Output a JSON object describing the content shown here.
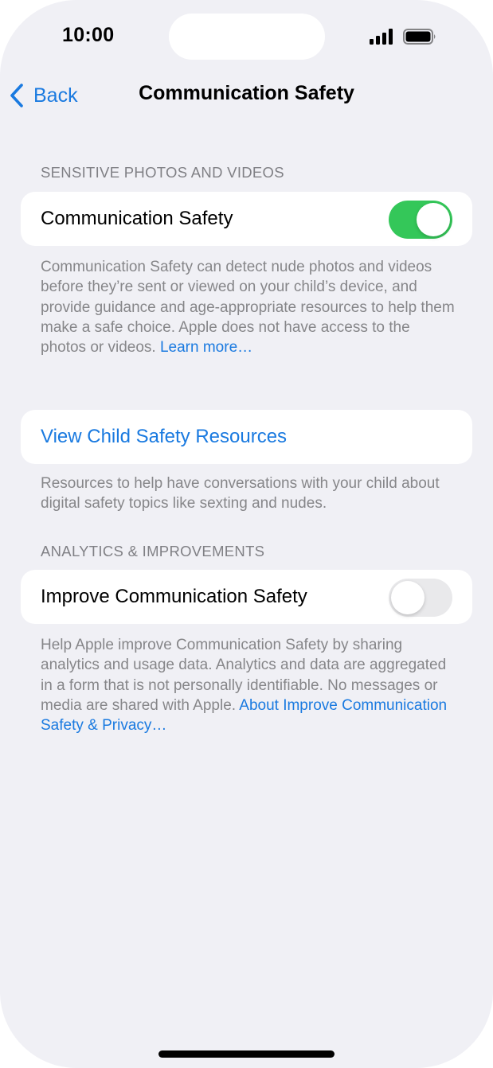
{
  "status_bar": {
    "time": "10:00",
    "signal_icon": "cellular-signal-icon",
    "battery_icon": "battery-full-icon"
  },
  "nav": {
    "back_label": "Back",
    "title": "Communication Safety"
  },
  "sections": {
    "sensitive": {
      "header": "SENSITIVE PHOTOS AND VIDEOS",
      "row_label": "Communication Safety",
      "toggle_on": true,
      "footer_text": "Communication Safety can detect nude photos and videos before they’re sent or viewed on your child’s device, and provide guidance and age-appropriate resources to help them make a safe choice. Apple does not have access to the photos or videos. ",
      "footer_link": "Learn more…"
    },
    "resources": {
      "row_label": "View Child Safety Resources",
      "footer_text": "Resources to help have conversations with your child about digital safety topics like sexting and nudes."
    },
    "analytics": {
      "header": "ANALYTICS & IMPROVEMENTS",
      "row_label": "Improve Communication Safety",
      "toggle_on": false,
      "footer_text": "Help Apple improve Communication Safety by sharing analytics and usage data. Analytics and data are aggregated in a form that is not personally identifiable. No messages or media are shared with Apple. ",
      "footer_link": "About Improve Communication Safety & Privacy…"
    }
  },
  "colors": {
    "accent": "#1a7ae0",
    "toggle_on": "#34c759",
    "toggle_off": "#e9e9eb",
    "background": "#f0f0f5",
    "secondary_text": "#868689"
  }
}
